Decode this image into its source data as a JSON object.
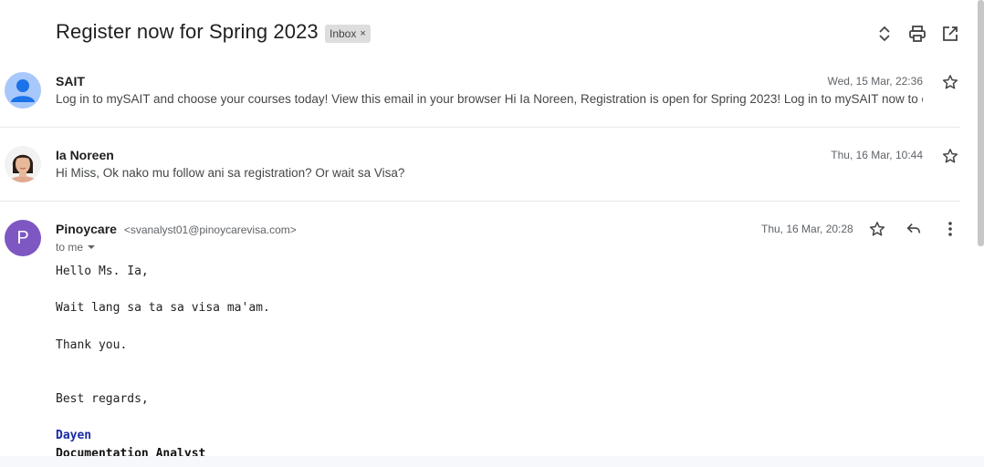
{
  "thread": {
    "subject": "Register now for Spring 2023",
    "label": "Inbox",
    "label_remove": "×"
  },
  "messages": [
    {
      "sender": "SAIT",
      "date": "Wed, 15 Mar, 22:36",
      "snippet": "Log in to mySAIT and choose your courses today! View this email in your browser Hi Ia Noreen, Registration is open for Spring 2023! Log in to mySAIT now to comp",
      "avatar_color": "#a8c7fa"
    },
    {
      "sender": "Ia Noreen",
      "date": "Thu, 16 Mar, 10:44",
      "snippet": "Hi Miss, Ok nako mu follow ani sa registration? Or wait sa Visa?"
    },
    {
      "sender": "Pinoycare",
      "sender_email": "<svanalyst01@pinoycarevisa.com>",
      "date": "Thu, 16 Mar, 20:28",
      "avatar_letter": "P",
      "avatar_color": "#7e57c2",
      "to": "to me",
      "body": {
        "greeting": "Hello Ms. Ia,",
        "line1": "Wait lang sa ta sa visa ma'am.",
        "line2": "Thank you.",
        "closing": "Best regards,",
        "sig_name": "Dayen",
        "sig_title": "Documentation Analyst"
      }
    }
  ]
}
